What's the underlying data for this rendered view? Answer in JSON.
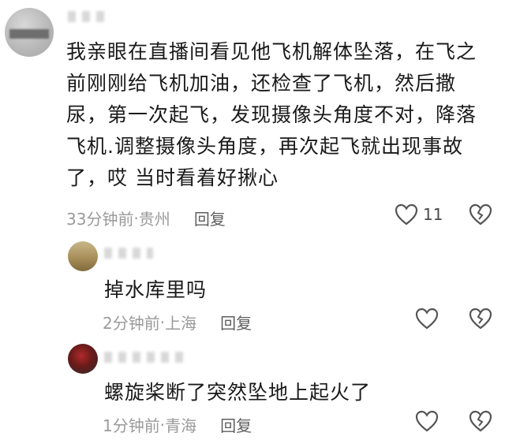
{
  "comment": {
    "text": "我亲眼在直播间看见他飞机解体坠落，在飞之前刚刚给飞机加油，还检查了飞机，然后撒尿，第一次起飞，发现摄像头角度不对，降落飞机.调整摄像头角度，再次起飞就出现事故了，哎 当时看着好揪心",
    "time": "33分钟前",
    "location": "贵州",
    "reply_label": "回复",
    "like_count": "11"
  },
  "replies": [
    {
      "text": "掉水库里吗",
      "time": "2分钟前",
      "location": "上海",
      "reply_label": "回复"
    },
    {
      "text": "螺旋桨断了突然坠地上起火了",
      "time": "1分钟前",
      "location": "青海",
      "reply_label": "回复"
    }
  ],
  "separator": " · "
}
